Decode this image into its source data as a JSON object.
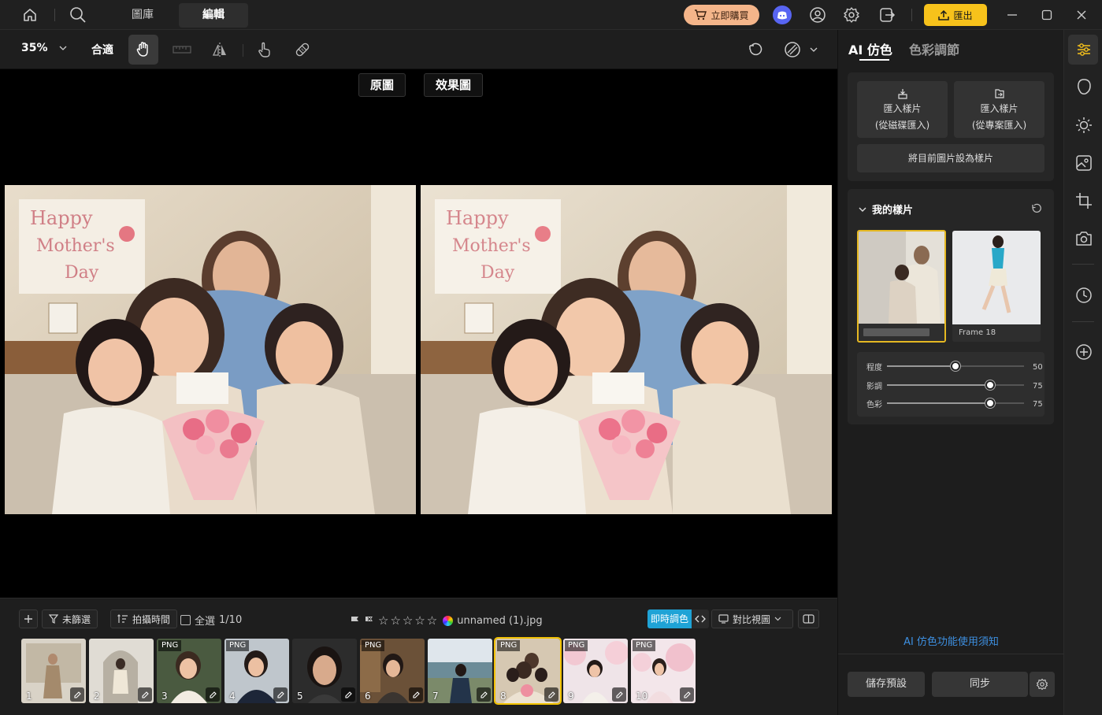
{
  "topbar": {
    "tabs": [
      {
        "label": "圖庫"
      },
      {
        "label": "編輯"
      }
    ],
    "active_tab": "編輯",
    "buy_label": "立即購買",
    "export_label": "匯出",
    "colors": {
      "buy_bg": "#f4b58a",
      "export_bg": "#f7c21b"
    }
  },
  "toolbar": {
    "zoom": "35%",
    "fit_label": "合適"
  },
  "canvas": {
    "original_label": "原圖",
    "effect_label": "效果圖"
  },
  "filter_bar": {
    "filter_label": "未篩選",
    "sort_label": "拍攝時間",
    "select_all_label": "全選",
    "count": "1/10",
    "filename": "unnamed (1).jpg",
    "live_adjust_label": "即時調色",
    "compare_view_label": "對比視圖",
    "colors": {
      "live_adjust_bg": "#1fa3d6"
    }
  },
  "thumbnails": [
    {
      "num": "1",
      "badge": "",
      "selected": false
    },
    {
      "num": "2",
      "badge": "",
      "selected": false
    },
    {
      "num": "3",
      "badge": "PNG",
      "selected": false
    },
    {
      "num": "4",
      "badge": "PNG",
      "selected": false
    },
    {
      "num": "5",
      "badge": "",
      "selected": false
    },
    {
      "num": "6",
      "badge": "PNG",
      "selected": false
    },
    {
      "num": "7",
      "badge": "",
      "selected": false
    },
    {
      "num": "8",
      "badge": "PNG",
      "selected": true
    },
    {
      "num": "9",
      "badge": "PNG",
      "selected": false
    },
    {
      "num": "10",
      "badge": "PNG",
      "selected": false
    }
  ],
  "right_panel": {
    "tabs": [
      {
        "label": "AI 仿色"
      },
      {
        "label": "色彩調節"
      }
    ],
    "import_disk_line1": "匯入樣片",
    "import_disk_line2": "(從磁碟匯入)",
    "import_project_line1": "匯入樣片",
    "import_project_line2": "(從專案匯入)",
    "set_sample_label": "將目前圖片設為樣片",
    "my_samples_title": "我的樣片",
    "sample_names": [
      "",
      "Frame 18"
    ],
    "sliders": [
      {
        "label": "程度",
        "value": 50,
        "max": 100
      },
      {
        "label": "影調",
        "value": 75,
        "max": 100
      },
      {
        "label": "色彩",
        "value": 75,
        "max": 100
      }
    ],
    "help_link": "AI 仿色功能使用須知",
    "save_preset_label": "儲存預設",
    "sync_label": "同步",
    "colors": {
      "link": "#3d8fe0",
      "accent": "#f7c21b"
    }
  }
}
